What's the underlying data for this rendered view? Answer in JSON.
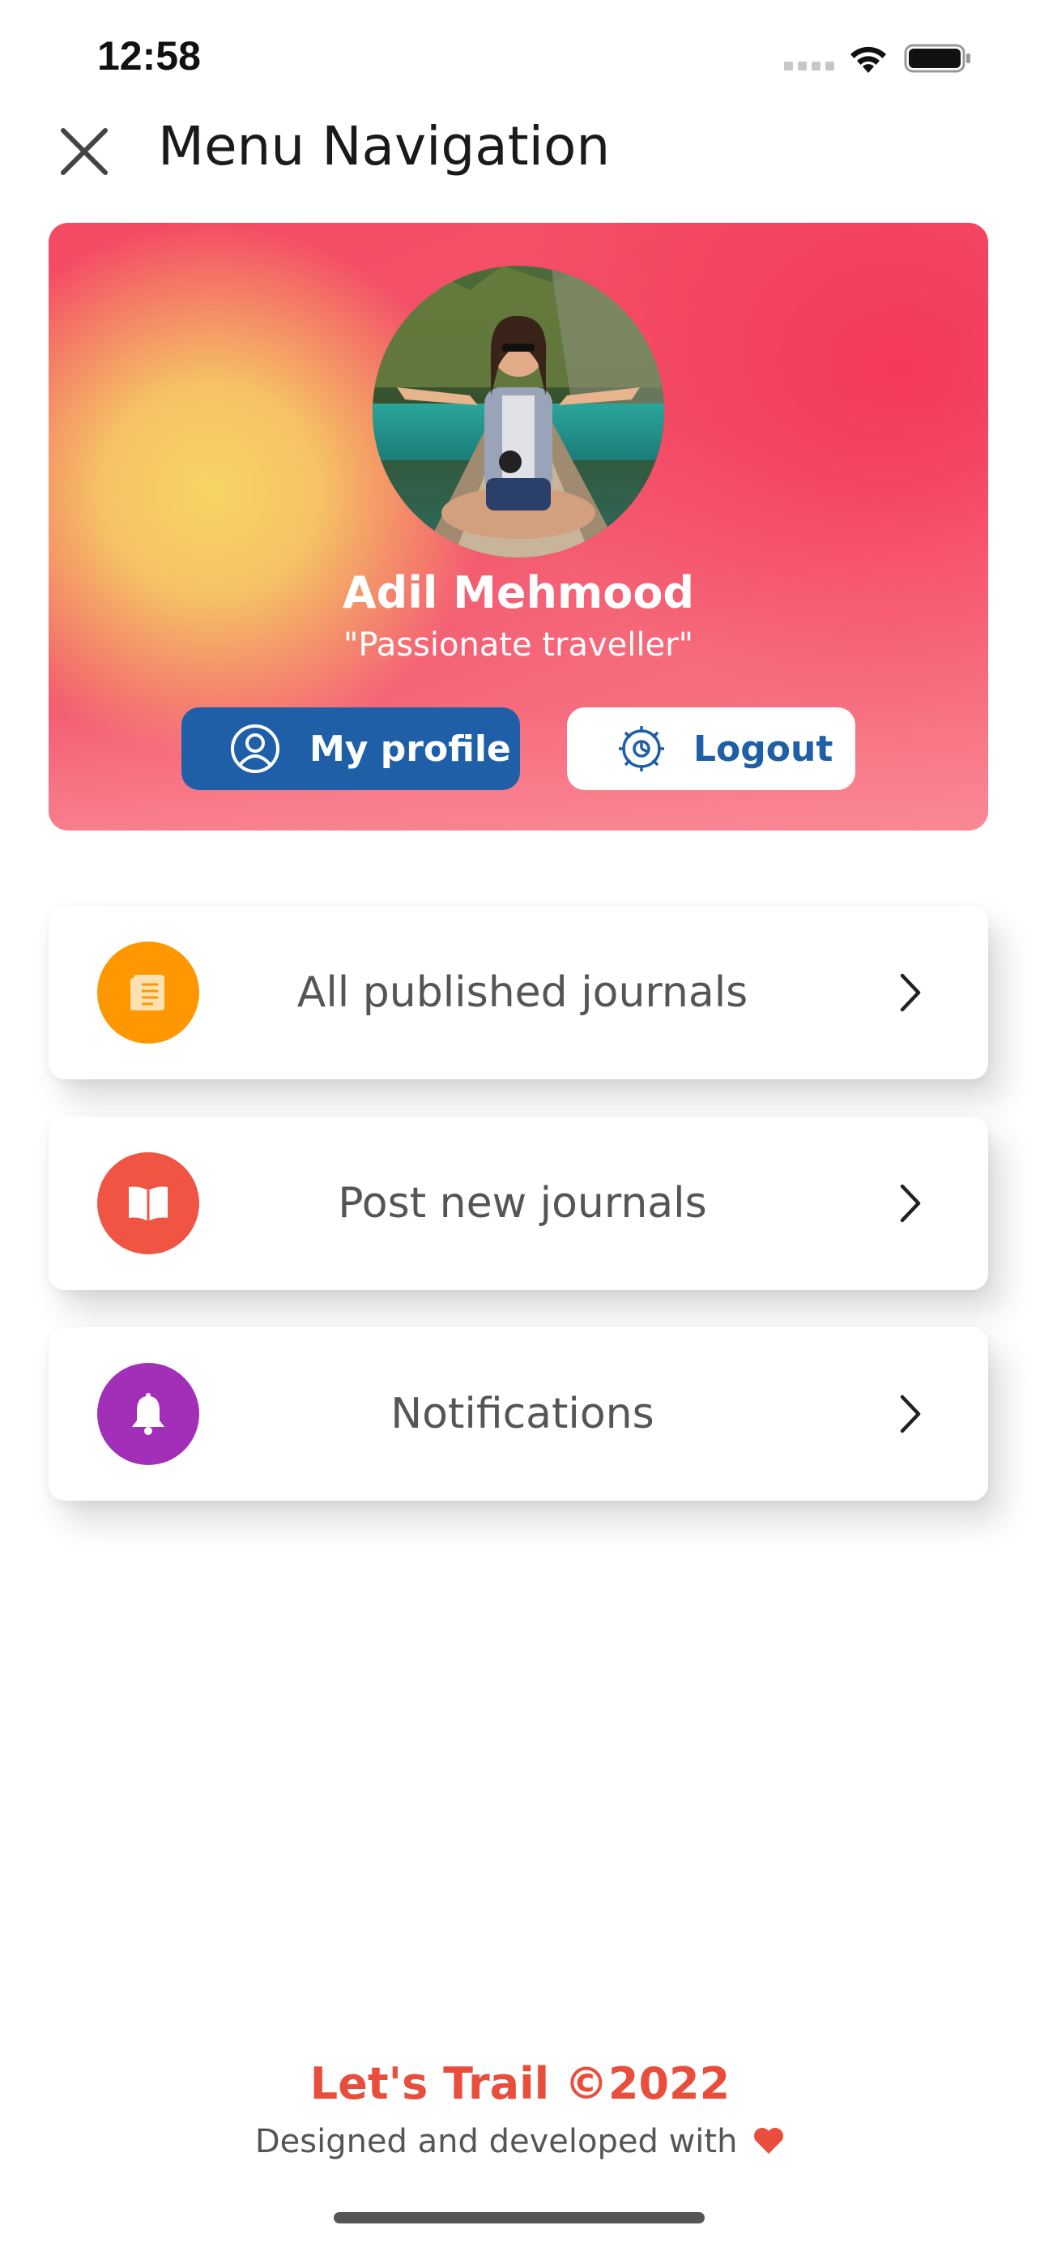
{
  "status_bar": {
    "time": "12:58",
    "icons": [
      "signal-icon",
      "wifi-icon",
      "battery-icon"
    ]
  },
  "header": {
    "title": "Menu Navigation",
    "close_icon": "close-icon"
  },
  "profile": {
    "name": "Adil Mehmood",
    "tagline": "\"Passionate traveller\"",
    "buttons": {
      "profile_label": "My profile",
      "profile_icon": "user-circle-icon",
      "logout_label": "Logout",
      "logout_icon": "gear-icon"
    }
  },
  "menu": {
    "items": [
      {
        "label": "All published journals",
        "icon": "document-icon",
        "color": "#ff9800"
      },
      {
        "label": "Post new journals",
        "icon": "book-open-icon",
        "color": "#ef5542"
      },
      {
        "label": "Notifications",
        "icon": "bell-icon",
        "color": "#a22fb8"
      }
    ]
  },
  "footer": {
    "brand": "Let's Trail ©2022",
    "credit": "Designed and developed with"
  },
  "colors": {
    "primary_blue": "#1e5fa8",
    "brand_red": "#e94e3c",
    "card_gradient_pink": "#f44a64",
    "card_gradient_yellow": "#f6d564"
  }
}
